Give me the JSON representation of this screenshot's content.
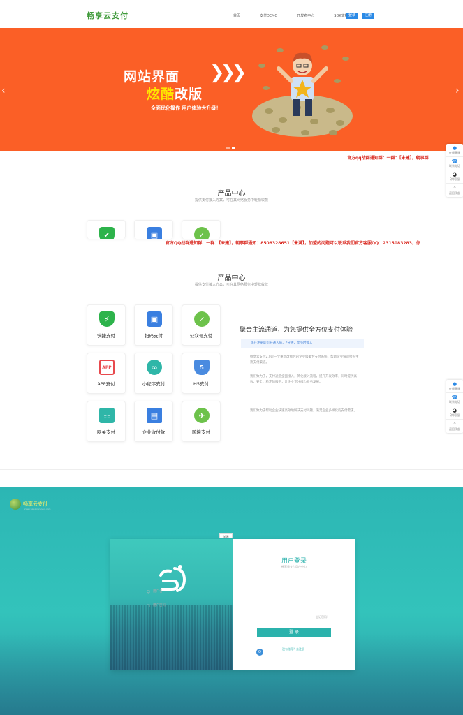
{
  "header": {
    "logo": "畅享云支付",
    "nav": [
      "首页",
      "支付DEMO",
      "开发者中心",
      "SDK文档"
    ],
    "login_label": "登录",
    "register_label": "注册"
  },
  "banner": {
    "title_line1": "网站界面",
    "title_line2_highlight": "炫酷",
    "title_line2_rest": "改版",
    "subtitle": "全面优化操作  用户体验大升级！",
    "slide_count": 2,
    "active_slide": 2
  },
  "notice": {
    "text1": "官方qq战群通知群：一群：【未建】，朝事群",
    "text2": "官方QQ战群通知群：一群：【未建】，朝事群通知：8508328651【未满】，加盟的问题可以联系我们官方客服QQ：2315083283，你"
  },
  "side_tool": {
    "items": [
      "在线客服",
      "联系电话",
      "QQ客服",
      "返回顶部"
    ]
  },
  "products": {
    "title": "产品中心",
    "subtitle": "提供支付接入方案，可在其网络服务中轻松收款",
    "items": [
      {
        "label": "快捷支付",
        "icon": "shield-icon",
        "color": "#2db34b"
      },
      {
        "label": "扫码支付",
        "icon": "scan-icon",
        "color": "#3a7fe0"
      },
      {
        "label": "公众号支付",
        "icon": "wechat-icon",
        "color": "#6dc24b"
      },
      {
        "label": "APP支付",
        "icon": "app-icon",
        "color": "#e8494d"
      },
      {
        "label": "小程序支付",
        "icon": "miniprogram-icon",
        "color": "#2fb6a8"
      },
      {
        "label": "H5支付",
        "icon": "html5-icon",
        "color": "#4a8be0"
      },
      {
        "label": "网关支付",
        "icon": "gateway-icon",
        "color": "#2fb6a8"
      },
      {
        "label": "企业收付款",
        "icon": "building-icon",
        "color": "#3a7fe0"
      },
      {
        "label": "跨境支付",
        "icon": "plane-icon",
        "color": "#6dc24b"
      }
    ],
    "agg_title": "聚合主流通道，为您提供全方位支付体验",
    "agg_tag": "现在注册即可开通入局，7分钟，享小时接入",
    "agg_paragraphs": [
      "畅享云支付2.0是一个重新改版后的企业级聚合支付系统，帮助企业快速接入主流支付渠道。",
      "我们致力于，支付通道全面接入，简化接入流程，提升开发效率，同时提供高效、安全、稳定的服务，让企业专注核心业务发展。",
      "我们致力于帮助企业快速高效地解决支付问题，满足企业多样化的支付需求。"
    ]
  },
  "login_page": {
    "logo_text": "畅享云支付",
    "logo_sub": "www.changxiangyun.com",
    "close_label": "关闭",
    "title": "用户登录",
    "subtitle": "畅享云支付用户中心",
    "username_placeholder": "用户名",
    "password_placeholder": "用户密码",
    "forgot_label": "忘记密码？",
    "submit_label": "登 录",
    "qq_label": "Q",
    "register_link": "没有账号？去注册"
  }
}
